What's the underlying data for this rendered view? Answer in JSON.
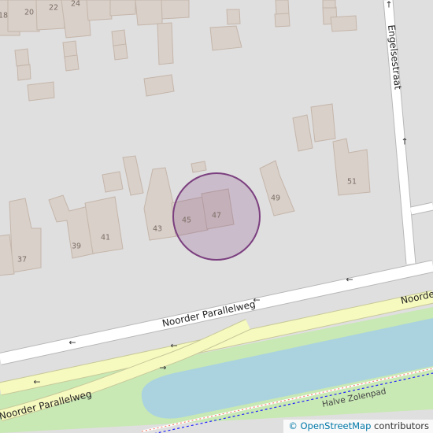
{
  "map": {
    "streets": {
      "noorder_parallelweg_upper": "Noorder Parallelweg",
      "noorder_parallelweg_lower": "Noorder Parallelweg",
      "noorder_right": "Noorder",
      "engelsestraat": "Engelsestraat",
      "halve_zolenpad": "Halve Zolenpad"
    },
    "house_numbers": {
      "n18": "18",
      "n20": "20",
      "n22": "22",
      "n24": "24",
      "n37": "37",
      "n39": "39",
      "n41": "41",
      "n43": "43",
      "n45": "45",
      "n47": "47",
      "n49": "49",
      "n51": "51"
    },
    "arrows": {
      "oneway_left": "←",
      "oneway_right": "→",
      "oneway_up": "↑"
    },
    "colors": {
      "background": "#e0dfdf",
      "building": "#d9d0c9",
      "road": "#ffffff",
      "primary_road": "#f7fabf",
      "water": "#aad3df",
      "grass": "#c8e8b4",
      "footway": "#fa8072",
      "cycleway": "#2020ff",
      "highlight_circle": "#7b3f7f"
    }
  },
  "attribution": {
    "copyright": "©",
    "link_text": "OpenStreetMap",
    "suffix": " contributors"
  }
}
